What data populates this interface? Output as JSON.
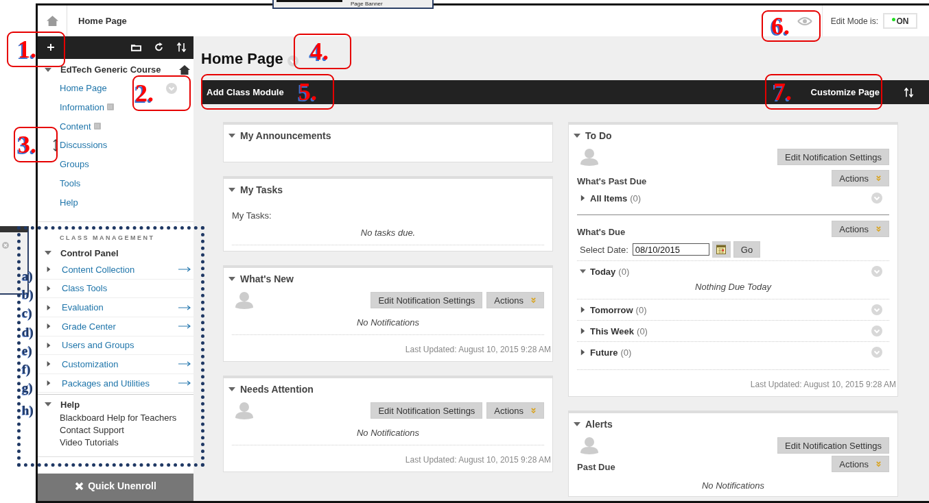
{
  "banner_popup": {
    "title": "Page Banner"
  },
  "header": {
    "breadcrumb": "Home Page",
    "edit_mode_label": "Edit Mode is:",
    "edit_mode": {
      "label": "ON",
      "on": true
    }
  },
  "sidebar": {
    "course": {
      "title": "EdTech Generic Course",
      "expanded": true
    },
    "menu": [
      {
        "label": "Home Page",
        "kind": "link",
        "menu_button": true
      },
      {
        "label": "Information",
        "kind": "content",
        "menu_button": false
      },
      {
        "label": "Content",
        "kind": "content",
        "menu_button": false
      },
      {
        "label": "Discussions",
        "kind": "link",
        "menu_button": false
      },
      {
        "label": "Groups",
        "kind": "link",
        "menu_button": false
      },
      {
        "label": "Tools",
        "kind": "link",
        "menu_button": false
      },
      {
        "label": "Help",
        "kind": "link",
        "menu_button": false
      }
    ],
    "management_heading": "CLASS MANAGEMENT",
    "control_panel": {
      "title": "Control Panel",
      "expanded": true,
      "items": [
        {
          "label": "Content Collection",
          "expanded": false,
          "arrow": true
        },
        {
          "label": "Class Tools",
          "expanded": false,
          "arrow": false
        },
        {
          "label": "Evaluation",
          "expanded": false,
          "arrow": true
        },
        {
          "label": "Grade Center",
          "expanded": false,
          "arrow": true
        },
        {
          "label": "Users and Groups",
          "expanded": false,
          "arrow": false
        },
        {
          "label": "Customization",
          "expanded": false,
          "arrow": true
        },
        {
          "label": "Packages and Utilities",
          "expanded": false,
          "arrow": true
        }
      ]
    },
    "help": {
      "title": "Help",
      "expanded": true,
      "items": [
        "Blackboard Help for Teachers",
        "Contact Support",
        "Video Tutorials"
      ]
    },
    "quick_unenroll": "Quick Unenroll"
  },
  "page": {
    "title": "Home Page",
    "add_module": "Add Class Module",
    "customize": "Customize Page"
  },
  "columns": [
    {
      "modules": [
        {
          "kind": "announcements",
          "title": "My Announcements",
          "expanded": true
        },
        {
          "kind": "tasks",
          "title": "My Tasks",
          "expanded": true,
          "label": "My Tasks:",
          "message": "No tasks due."
        },
        {
          "kind": "notifications",
          "title": "What's New",
          "expanded": true,
          "edit_button": "Edit Notification Settings",
          "actions_button": "Actions",
          "message": "No Notifications",
          "last_updated": "Last Updated: August 10, 2015 9:28 AM"
        },
        {
          "kind": "notifications",
          "title": "Needs Attention",
          "expanded": true,
          "edit_button": "Edit Notification Settings",
          "actions_button": "Actions",
          "message": "No Notifications",
          "last_updated": "Last Updated: August 10, 2015 9:28 AM"
        }
      ]
    },
    {
      "modules": [
        {
          "kind": "todo",
          "title": "To Do",
          "expanded": true,
          "edit_button": "Edit Notification Settings",
          "sections": [
            {
              "title": "What's Past Due",
              "actions_button": "Actions",
              "groups": [
                {
                  "label": "All Items",
                  "count": "(0)",
                  "expanded": false
                }
              ]
            },
            {
              "title": "What's Due",
              "actions_button": "Actions",
              "date_label": "Select Date:",
              "date_value": "08/10/2015",
              "go_button": "Go",
              "groups": [
                {
                  "label": "Today",
                  "count": "(0)",
                  "expanded": true,
                  "message": "Nothing Due Today"
                },
                {
                  "label": "Tomorrow",
                  "count": "(0)",
                  "expanded": false
                },
                {
                  "label": "This Week",
                  "count": "(0)",
                  "expanded": false
                },
                {
                  "label": "Future",
                  "count": "(0)",
                  "expanded": false
                }
              ]
            }
          ],
          "last_updated": "Last Updated: August 10, 2015 9:28 AM"
        },
        {
          "kind": "alerts",
          "title": "Alerts",
          "expanded": true,
          "edit_button": "Edit Notification Settings",
          "section_title": "Past Due",
          "actions_button": "Actions",
          "message": "No Notifications"
        }
      ]
    }
  ],
  "annotations": {
    "callouts": [
      "1.",
      "2.",
      "3.",
      "4.",
      "5.",
      "6.",
      "7."
    ],
    "letters": [
      "a)",
      "b)",
      "c)",
      "d)",
      "e)",
      "f)",
      "g)",
      "h)"
    ]
  }
}
